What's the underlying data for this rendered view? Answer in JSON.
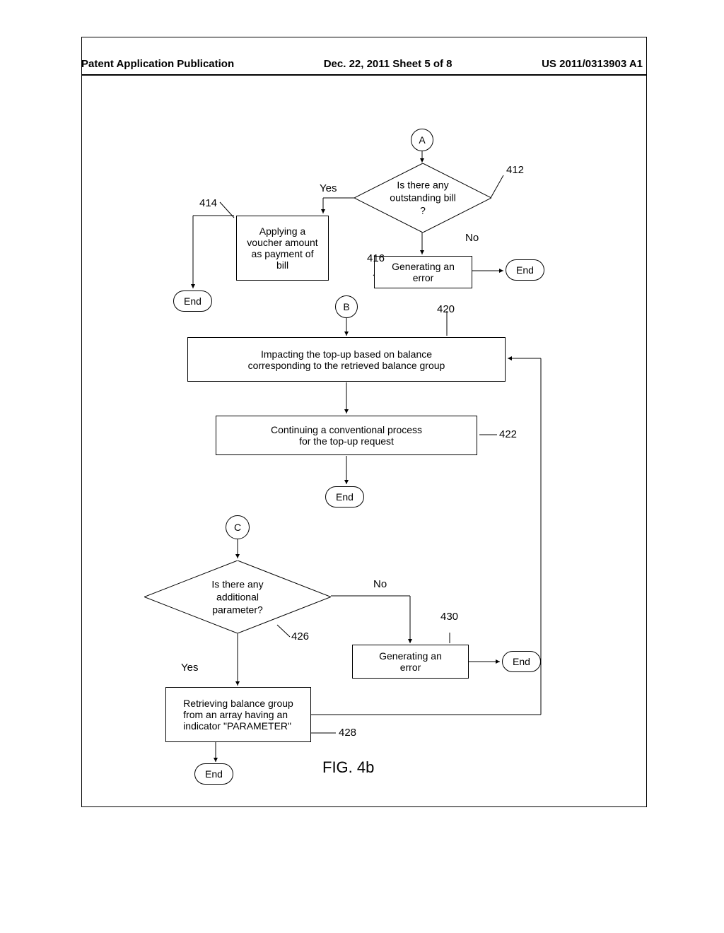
{
  "header": {
    "left": "Patent Application Publication",
    "mid": "Dec. 22, 2011  Sheet 5 of 8",
    "right": "US 2011/0313903 A1"
  },
  "connectors": {
    "A": "A",
    "B": "B",
    "C": "C"
  },
  "decisions": {
    "d412": "Is there any\noutstanding bill ?",
    "d426": "Is there any additional\nparameter?",
    "yes": "Yes",
    "no": "No"
  },
  "processes": {
    "p414": "Applying a\nvoucher amount\nas payment of\nbill",
    "p416": "Generating an\nerror",
    "p420": "Impacting the top-up based on balance\ncorresponding to the retrieved balance group",
    "p422": "Continuing a conventional process\nfor the top-up request",
    "p428": "Retrieving balance group\nfrom an array having an\nindicator  \"PARAMETER\"",
    "p430": "Generating an\nerror"
  },
  "terminators": {
    "end": "End"
  },
  "refs": {
    "r412": "412",
    "r414": "414",
    "r416": "416",
    "r420": "420",
    "r422": "422",
    "r426": "426",
    "r428": "428",
    "r430": "430"
  },
  "figure": "FIG. 4b",
  "chart_data": {
    "type": "flowchart",
    "title": "FIG. 4b",
    "nodes": [
      {
        "id": "A",
        "kind": "connector",
        "label": "A"
      },
      {
        "id": "412",
        "kind": "decision",
        "label": "Is there any outstanding bill ?"
      },
      {
        "id": "414",
        "kind": "process",
        "label": "Applying a voucher amount as payment of bill"
      },
      {
        "id": "416",
        "kind": "process",
        "label": "Generating an error"
      },
      {
        "id": "End_A1",
        "kind": "terminator",
        "label": "End"
      },
      {
        "id": "End_A2",
        "kind": "terminator",
        "label": "End"
      },
      {
        "id": "B",
        "kind": "connector",
        "label": "B"
      },
      {
        "id": "420",
        "kind": "process",
        "label": "Impacting the top-up based on balance corresponding to the retrieved balance group"
      },
      {
        "id": "422",
        "kind": "process",
        "label": "Continuing a conventional process for the top-up request"
      },
      {
        "id": "End_B",
        "kind": "terminator",
        "label": "End"
      },
      {
        "id": "C",
        "kind": "connector",
        "label": "C"
      },
      {
        "id": "426",
        "kind": "decision",
        "label": "Is there any additional parameter?"
      },
      {
        "id": "428",
        "kind": "process",
        "label": "Retrieving balance group from an array having an indicator \"PARAMETER\""
      },
      {
        "id": "430",
        "kind": "process",
        "label": "Generating an error"
      },
      {
        "id": "End_C1",
        "kind": "terminator",
        "label": "End"
      },
      {
        "id": "End_C2",
        "kind": "terminator",
        "label": "End"
      }
    ],
    "edges": [
      {
        "from": "A",
        "to": "412"
      },
      {
        "from": "412",
        "to": "414",
        "label": "Yes"
      },
      {
        "from": "412",
        "to": "416",
        "label": "No"
      },
      {
        "from": "414",
        "to": "End_A1"
      },
      {
        "from": "416",
        "to": "End_A2"
      },
      {
        "from": "B",
        "to": "420"
      },
      {
        "from": "420",
        "to": "422"
      },
      {
        "from": "422",
        "to": "End_B"
      },
      {
        "from": "C",
        "to": "426"
      },
      {
        "from": "426",
        "to": "428",
        "label": "Yes"
      },
      {
        "from": "426",
        "to": "430",
        "label": "No"
      },
      {
        "from": "428",
        "to": "420"
      },
      {
        "from": "428",
        "to": "End_C1"
      },
      {
        "from": "430",
        "to": "End_C2"
      }
    ]
  }
}
